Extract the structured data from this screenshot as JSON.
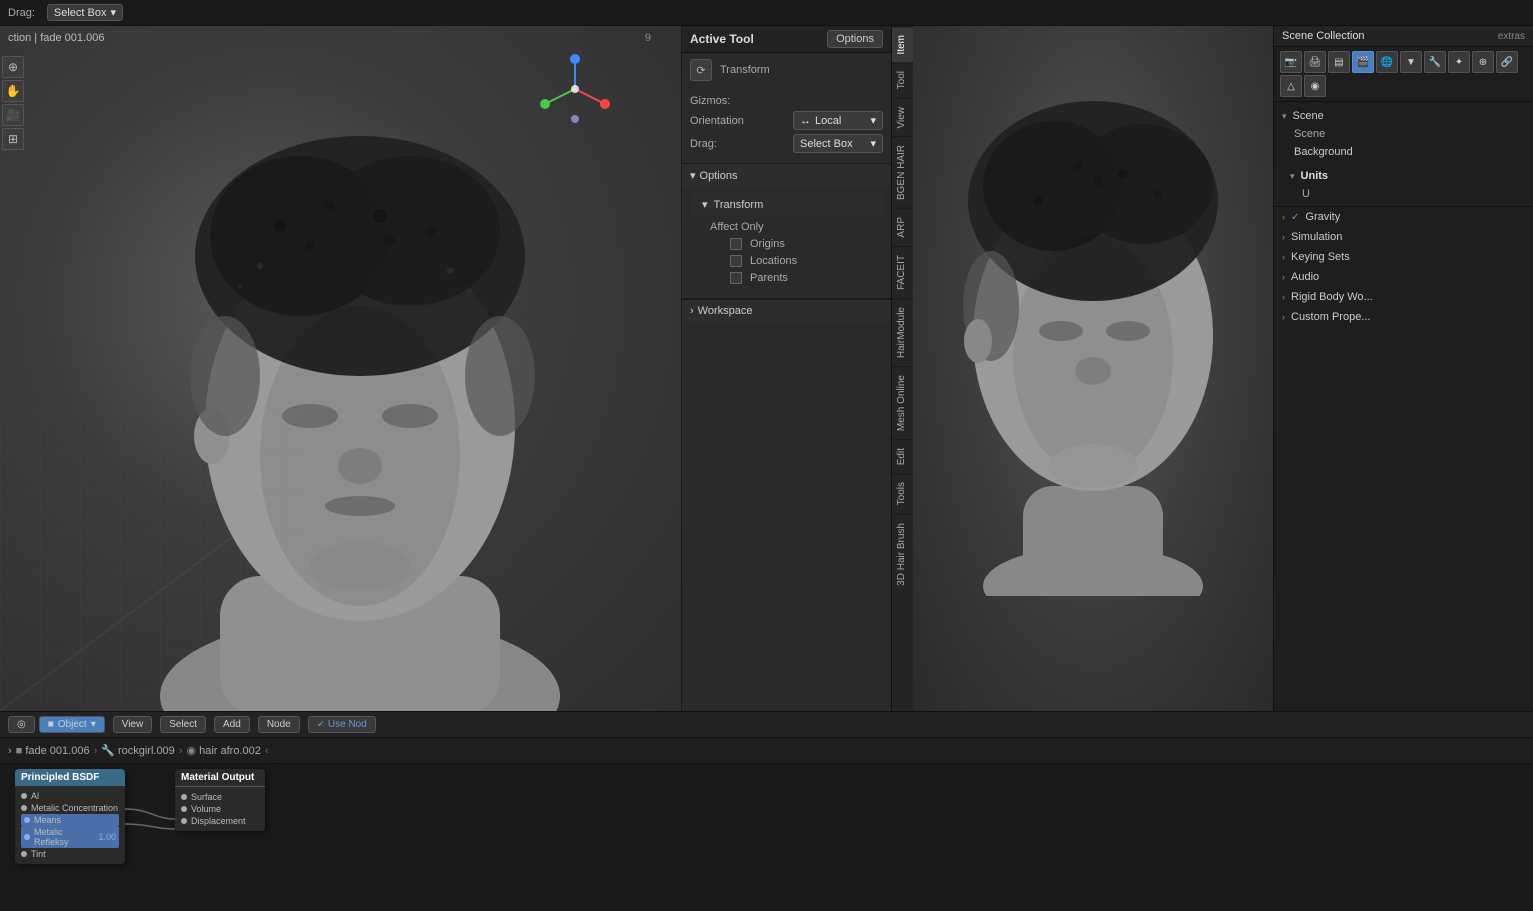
{
  "topbar": {
    "drag_label": "Drag:",
    "select_box_label": "Select Box",
    "select_box_arrow": "▾",
    "breadcrumb": "ction | fade 001.006"
  },
  "options_button": "Options",
  "tool_panel": {
    "title": "Active Tool",
    "active_tool_label": "Active Tool",
    "transform_label": "Transform",
    "gizmos_label": "Gizmos:",
    "orientation_label": "Orientation",
    "orientation_value": "Local",
    "orientation_icon": "↔",
    "drag_label": "Drag:",
    "drag_value": "Select Box",
    "options_label": "Options",
    "transform_section": "Transform",
    "affect_only_label": "Affect Only",
    "origins_label": "Origins",
    "locations_label": "Locations",
    "parents_label": "Parents",
    "workspace_label": "Workspace"
  },
  "vertical_tabs": [
    {
      "label": "Item",
      "active": false
    },
    {
      "label": "Tool",
      "active": false
    },
    {
      "label": "View",
      "active": false
    },
    {
      "label": "BGEN HAIR",
      "active": false
    },
    {
      "label": "ARP",
      "active": false
    },
    {
      "label": "FACEIT",
      "active": false
    },
    {
      "label": "HairModule",
      "active": false
    },
    {
      "label": "Mesh Online",
      "active": false
    },
    {
      "label": "Edit",
      "active": false
    },
    {
      "label": "Tools",
      "active": false
    },
    {
      "label": "3D Hair Brush",
      "active": false
    }
  ],
  "scene_collection": {
    "title": "Scene Collection",
    "extras_label": "extras",
    "scene_label": "Scene",
    "scene_item": "Scene",
    "background_label": "Background",
    "units_label": "Units",
    "units_placeholder": "U",
    "gravity_label": "Gravity",
    "simulation_label": "Simulation",
    "keying_sets_label": "Keying Sets",
    "audio_label": "Audio",
    "rigid_body_world_label": "Rigid Body Wo...",
    "custom_props_label": "Custom Prope..."
  },
  "properties_icons": [
    {
      "name": "render-icon",
      "symbol": "📷",
      "active": false
    },
    {
      "name": "output-icon",
      "symbol": "🖨",
      "active": false
    },
    {
      "name": "view-layer-icon",
      "symbol": "📋",
      "active": false
    },
    {
      "name": "scene-icon",
      "symbol": "🎬",
      "active": true
    },
    {
      "name": "world-icon",
      "symbol": "🌐",
      "active": false
    },
    {
      "name": "object-icon",
      "symbol": "▼",
      "active": false
    },
    {
      "name": "modifier-icon",
      "symbol": "🔧",
      "active": false
    },
    {
      "name": "particles-icon",
      "symbol": "✦",
      "active": false
    },
    {
      "name": "physics-icon",
      "symbol": "⊕",
      "active": false
    },
    {
      "name": "constraints-icon",
      "symbol": "🔗",
      "active": false
    },
    {
      "name": "data-icon",
      "symbol": "△",
      "active": false
    },
    {
      "name": "material-icon",
      "symbol": "◉",
      "active": false
    }
  ],
  "bottom": {
    "toolbar": {
      "object_btn": "Object",
      "view_btn": "View",
      "select_btn": "Select",
      "add_btn": "Add",
      "node_btn": "Node",
      "use_nod_btn": "✓ Use Nod"
    },
    "breadcrumbs": [
      {
        "label": "fade 001.006",
        "icon": "■"
      },
      {
        "label": "rockgirl.009",
        "icon": "🔧"
      },
      {
        "label": "hair afro.002",
        "icon": "◉"
      }
    ]
  },
  "node_editor": {
    "principled_bsdf": {
      "title": "Principled BSDF",
      "fields": [
        "Al",
        "Metalic Concentration",
        "Means",
        "Metalic Refleksy",
        "Tint"
      ]
    },
    "material_output": {
      "title": "Material Output",
      "fields": [
        "Surface",
        "Volume",
        "Displacement"
      ]
    }
  },
  "viewport_number": "9"
}
